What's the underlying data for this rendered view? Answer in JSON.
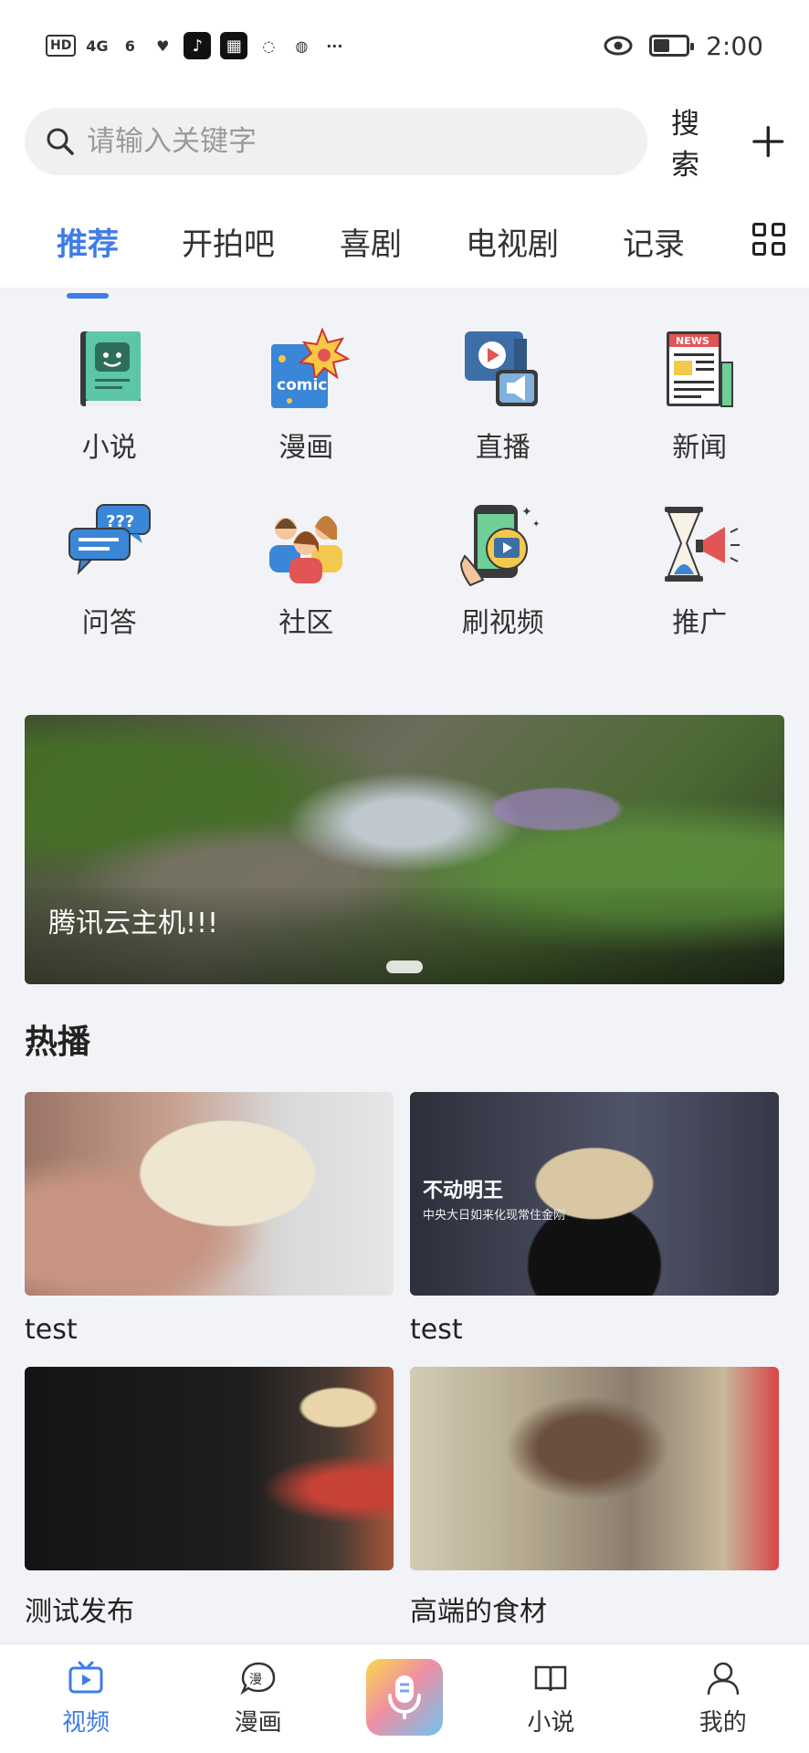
{
  "status_bar": {
    "left_indicators": [
      "HD",
      "4G",
      "6",
      "♥",
      "♪",
      "▦",
      "◌",
      "◍",
      "···"
    ],
    "time": "2:00"
  },
  "search": {
    "placeholder": "请输入关键字",
    "button_label": "搜索",
    "add_icon": "plus-icon"
  },
  "tabs": [
    {
      "label": "推荐",
      "active": true
    },
    {
      "label": "开拍吧",
      "active": false
    },
    {
      "label": "喜剧",
      "active": false
    },
    {
      "label": "电视剧",
      "active": false
    },
    {
      "label": "记录",
      "active": false
    }
  ],
  "categories": [
    {
      "label": "小说",
      "icon": "book-icon"
    },
    {
      "label": "漫画",
      "icon": "comic-icon"
    },
    {
      "label": "直播",
      "icon": "live-icon"
    },
    {
      "label": "新闻",
      "icon": "news-icon"
    },
    {
      "label": "问答",
      "icon": "qa-icon"
    },
    {
      "label": "社区",
      "icon": "community-icon"
    },
    {
      "label": "刷视频",
      "icon": "short-video-icon"
    },
    {
      "label": "推广",
      "icon": "promotion-icon"
    }
  ],
  "banner": {
    "caption": "腾讯云主机!!!"
  },
  "hot": {
    "title": "热播",
    "items": [
      {
        "title": "test"
      },
      {
        "title": "test",
        "overlay": "不动明王",
        "overlay_sub": "中央大日如来化现常住金刚"
      },
      {
        "title": "测试发布"
      },
      {
        "title": "高端的食材"
      }
    ]
  },
  "bottom_nav": [
    {
      "label": "视频",
      "active": true
    },
    {
      "label": "漫画",
      "active": false
    },
    {
      "label": "",
      "center": true
    },
    {
      "label": "小说",
      "active": false
    },
    {
      "label": "我的",
      "active": false
    }
  ],
  "colors": {
    "accent": "#3f7ce8",
    "background": "#f2f3f6"
  }
}
